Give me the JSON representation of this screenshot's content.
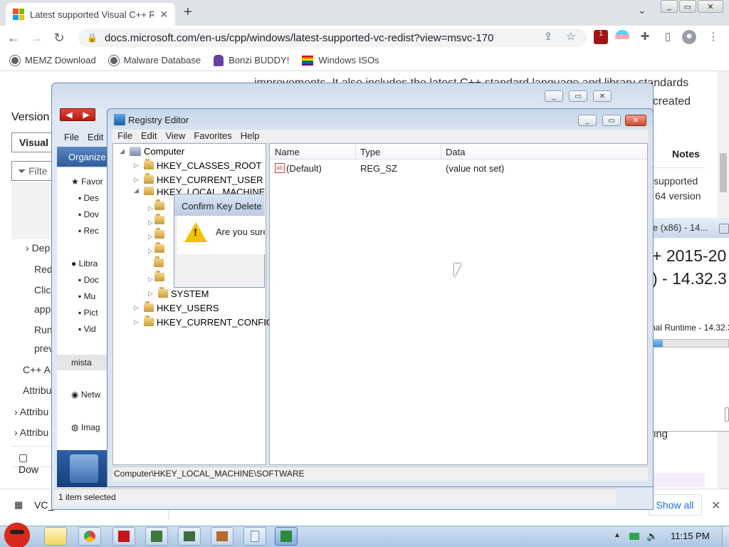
{
  "browser": {
    "tab_title": "Latest supported Visual C++ R",
    "tab_close": "✕",
    "new_tab": "+",
    "tab_dropdown": "⌄",
    "window_buttons": [
      "_",
      "▭",
      "✕"
    ],
    "nav": {
      "back": "←",
      "forward": "→",
      "reload": "↻"
    },
    "url": "docs.microsoft.com/en-us/cpp/windows/latest-supported-vc-redist?view=msvc-170",
    "lock": "🔒",
    "toolbar_icons": [
      "share-icon",
      "star-icon",
      "extension-badge-icon",
      "flag-icon",
      "puzzle-icon",
      "sidepanel-icon",
      "profile-icon",
      "menu-icon"
    ],
    "extension_badge": "1",
    "bookmarks": [
      {
        "label": "MEMZ Download",
        "icon": "globe-icon"
      },
      {
        "label": "Malware Database",
        "icon": "globe-icon"
      },
      {
        "label": "Bonzi BUDDY!",
        "icon": "bonzi-icon"
      },
      {
        "label": "Windows ISOs",
        "icon": "windows-flag-icon"
      }
    ]
  },
  "page": {
    "para_line1": "improvements. It also includes the latest C++ standard language and library standards",
    "para_line2": "ications created",
    "version_heading": "Version",
    "version_select": "Visual",
    "filter_placeholder": "Filte",
    "notes_header": "Notes",
    "right_note1": "supported",
    "right_note2": "64 version",
    "left_items": [
      "Dep",
      "Red",
      "Clic",
      "app",
      "Run",
      "prev",
      "C++ A",
      "Attribu",
      "Attribu",
      "Attribu",
      "Dow"
    ],
    "right_ing": "ing",
    "bottom_download": "VC_",
    "show_all": "Show all",
    "close_download": "✕"
  },
  "explorer": {
    "menu": [
      "File",
      "Edit"
    ],
    "organize": "Organize",
    "nav_items": [
      "Favor",
      "Des",
      "Dov",
      "Rec",
      "Libra",
      "Doc",
      "Mu",
      "Pict",
      "Vid",
      "mista",
      "Netw",
      "Imag"
    ],
    "status": "1 item selected",
    "window_buttons": [
      "_",
      "▭",
      "✕"
    ]
  },
  "installer": {
    "title": "le (x86) - 14...",
    "heading1": "+ 2015-20",
    "heading2": ") - 14.32.3",
    "runtime": "nal Runtime - 14.32.3",
    "progress": 0.04
  },
  "regedit": {
    "title": "Registry Editor",
    "window_buttons": [
      "_",
      "▭",
      "✕"
    ],
    "menu": [
      "File",
      "Edit",
      "View",
      "Favorites",
      "Help"
    ],
    "tree": {
      "root": "Computer",
      "hives": [
        "HKEY_CLASSES_ROOT",
        "HKEY_CURRENT_USER",
        "HKEY_LOCAL_MACHINE"
      ],
      "system": "SYSTEM",
      "users": "HKEY_USERS",
      "config": "HKEY_CURRENT_CONFIG"
    },
    "columns": [
      "Name",
      "Type",
      "Data"
    ],
    "row": {
      "name": "(Default)",
      "type": "REG_SZ",
      "data": "(value not set)",
      "icon": "ab"
    },
    "status_path": "Computer\\HKEY_LOCAL_MACHINE\\SOFTWARE"
  },
  "confirm": {
    "title": "Confirm Key Delete",
    "message": "Are you sure",
    "icon": "warning-icon"
  },
  "taskbar": {
    "apps": [
      "explorer-icon",
      "chrome-icon",
      "pdf-icon",
      "installer-icon",
      "network-icon",
      "paint-icon",
      "notepad-icon",
      "regedit-icon"
    ],
    "tray_arrow": "▲",
    "clock": "11:15 PM"
  }
}
